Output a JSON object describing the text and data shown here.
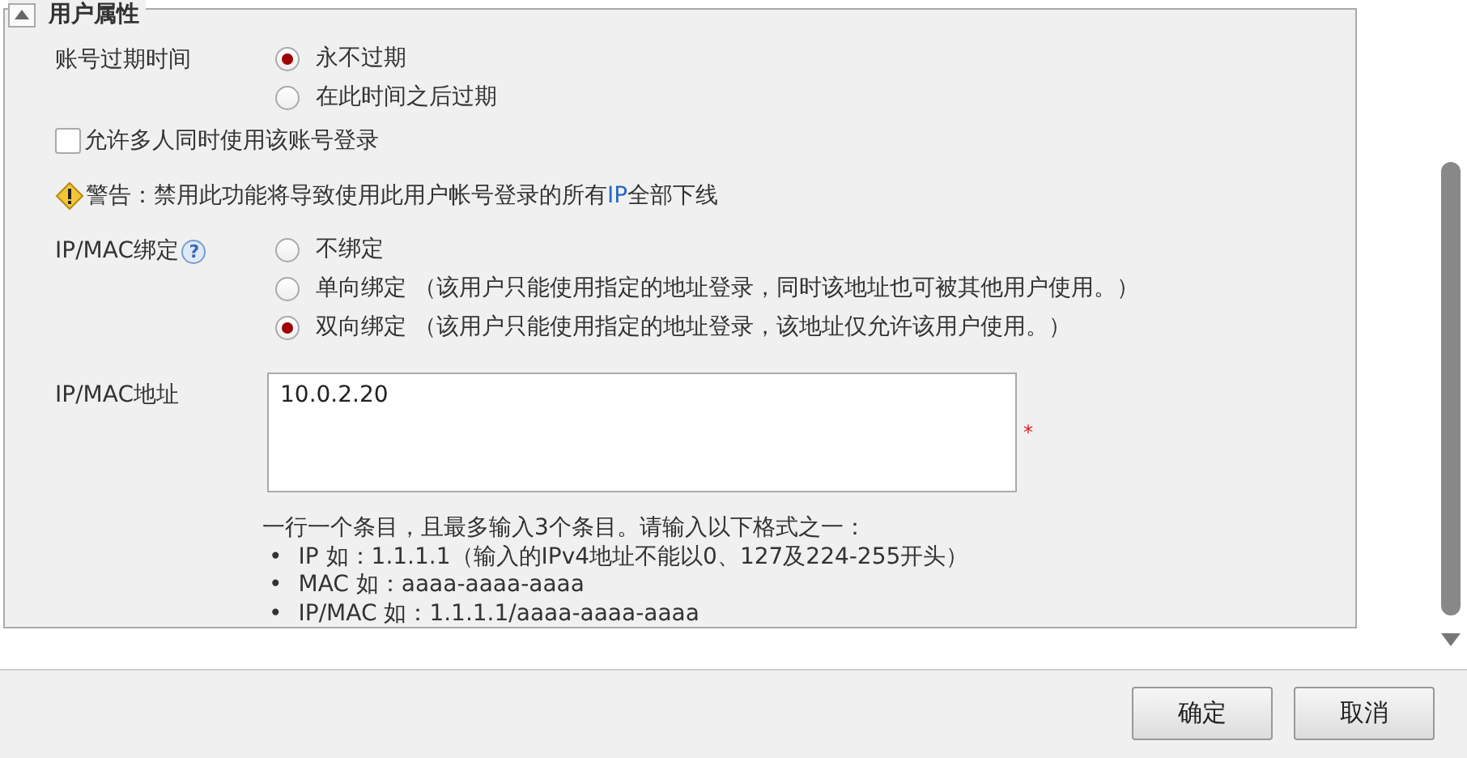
{
  "section": {
    "title": "用户属性",
    "expanded": true
  },
  "expiry": {
    "label": "账号过期时间",
    "options": [
      {
        "label": "永不过期",
        "selected": true
      },
      {
        "label": "在此时间之后过期",
        "selected": false
      }
    ]
  },
  "multi_login": {
    "label": "允许多人同时使用该账号登录",
    "checked": false
  },
  "warning": {
    "segments": [
      {
        "kind": "plain",
        "text": "警告：禁用此功能将导致使用此用户帐号登录的所有"
      },
      {
        "kind": "accent",
        "text": "IP"
      },
      {
        "kind": "plain",
        "text": "全部下线"
      }
    ]
  },
  "binding": {
    "label": "IP/MAC绑定",
    "help": "?",
    "options": [
      {
        "label": "不绑定",
        "selected": false
      },
      {
        "label": "单向绑定 （该用户只能使用指定的地址登录，同时该地址也可被其他用户使用。）",
        "selected": false
      },
      {
        "label": "双向绑定 （该用户只能使用指定的地址登录，该地址仅允许该用户使用。）",
        "selected": true
      }
    ]
  },
  "address": {
    "label": "IP/MAC地址",
    "value": "10.0.2.20",
    "required_mark": "*"
  },
  "hint": {
    "intro": "一行一个条目，且最多输入3个条目。请输入以下格式之一：",
    "items": [
      {
        "marker": "•",
        "text": "IP 如：1.1.1.1（输入的IPv4地址不能以0、127及224-255开头）"
      },
      {
        "marker": "•",
        "text": "MAC 如：aaaa-aaaa-aaaa"
      },
      {
        "marker": "•",
        "text": "IP/MAC 如：1.1.1.1/aaaa-aaaa-aaaa"
      }
    ]
  },
  "buttons": [
    {
      "label": "确定"
    },
    {
      "label": "取消"
    }
  ]
}
